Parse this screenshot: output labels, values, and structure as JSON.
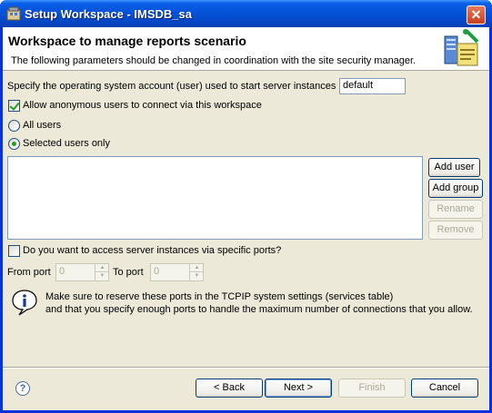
{
  "window": {
    "title": "Setup Workspace - IMSDB_sa",
    "close_glyph": "✕"
  },
  "header": {
    "title": "Workspace to manage reports scenario",
    "subtitle": "The following parameters should be changed in coordination with the site security manager.",
    "icon": "workspace-security-icon"
  },
  "account": {
    "label": "Specify the operating system account (user) used to start server instances",
    "value": "default"
  },
  "anonymous": {
    "label": "Allow anonymous users to connect via this workspace",
    "checked": true
  },
  "users": {
    "all_label": "All users",
    "selected_label": "Selected users only",
    "selected_option": "Selected users only",
    "list_items": []
  },
  "user_buttons": {
    "add_user": "Add user",
    "add_group": "Add group",
    "rename": "Rename",
    "remove": "Remove"
  },
  "ports": {
    "question": "Do you want to access server instances via specific ports?",
    "checked": false,
    "from_label": "From port",
    "from_value": "0",
    "to_label": "To port",
    "to_value": "0"
  },
  "info": {
    "line1": "Make sure to reserve these ports in the TCPIP system settings (services table)",
    "line2": "and that you specify enough ports to handle the maximum number of connections that you allow."
  },
  "footer": {
    "help_glyph": "?",
    "back": "< Back",
    "next": "Next >",
    "finish": "Finish",
    "cancel": "Cancel"
  },
  "colors": {
    "title_bar": "#0553d9",
    "dialog_bg": "#ece9d8",
    "check_mark": "#21a121"
  }
}
